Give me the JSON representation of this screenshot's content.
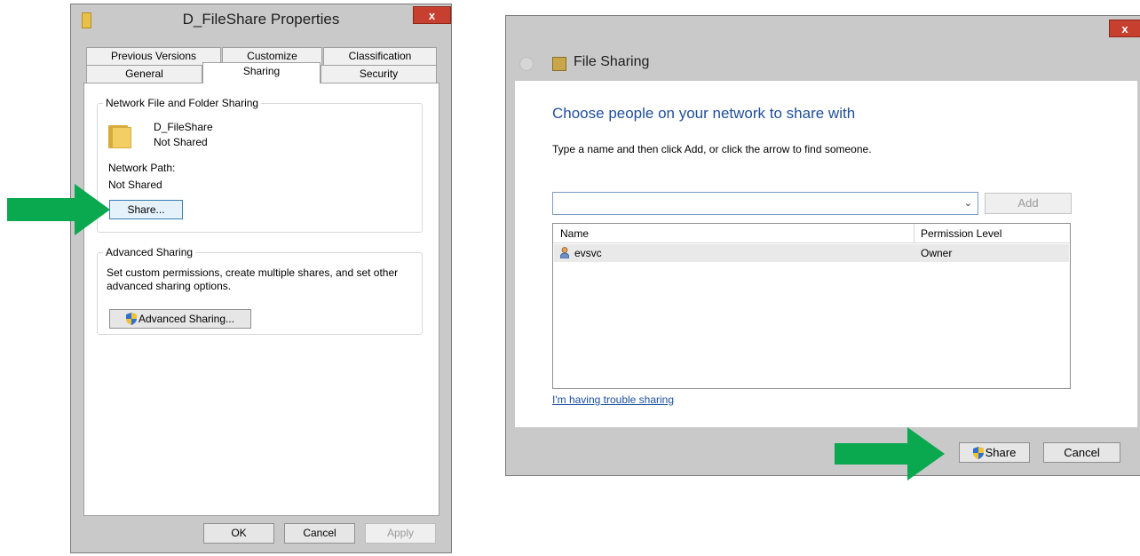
{
  "properties_dialog": {
    "title": "D_FileShare Properties",
    "close_label": "x",
    "tabs_row1": [
      "Previous Versions",
      "Customize",
      "Classification"
    ],
    "tabs_row2": [
      "General",
      "Sharing",
      "Security"
    ],
    "active_tab": "Sharing",
    "network_sharing": {
      "group_title": "Network File and Folder Sharing",
      "folder_name": "D_FileShare",
      "folder_status": "Not Shared",
      "path_label": "Network Path:",
      "path_value": "Not Shared",
      "share_button": "Share..."
    },
    "advanced_sharing": {
      "group_title": "Advanced Sharing",
      "description_line1": "Set custom permissions, create multiple shares, and set other",
      "description_line2": "advanced sharing options.",
      "button": "Advanced Sharing..."
    },
    "footer": {
      "ok": "OK",
      "cancel": "Cancel",
      "apply": "Apply"
    }
  },
  "file_sharing_dialog": {
    "title": "File Sharing",
    "close_label": "x",
    "heading": "Choose people on your network to share with",
    "instruction": "Type a name and then click Add, or click the arrow to find someone.",
    "name_input": {
      "value": "",
      "placeholder": ""
    },
    "add_button": "Add",
    "table": {
      "columns": [
        "Name",
        "Permission Level"
      ],
      "rows": [
        {
          "name": "evsvc",
          "permission": "Owner"
        }
      ]
    },
    "trouble_link": "I'm having trouble sharing",
    "share_button": "Share",
    "cancel_button": "Cancel"
  },
  "colors": {
    "arrow": "#0aa84f",
    "heading": "#1f4e9a",
    "close": "#c7402f",
    "link": "#1a4fa0"
  }
}
